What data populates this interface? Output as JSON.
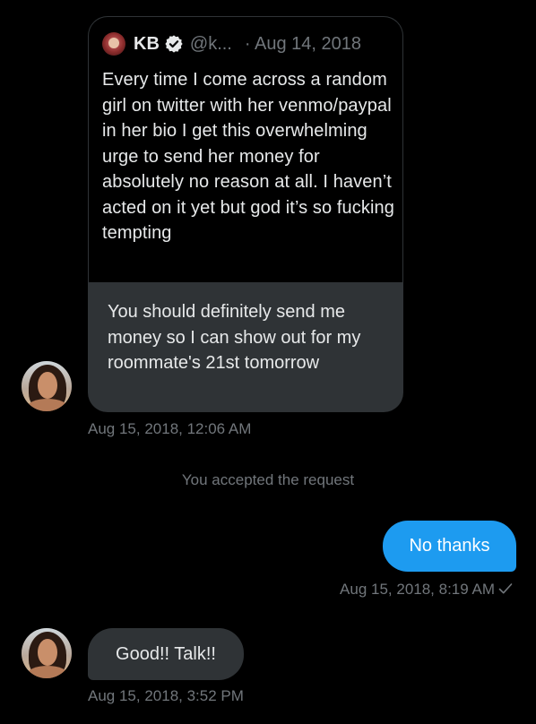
{
  "conversation": {
    "quoted_tweet": {
      "author_name": "KB",
      "handle": "@k...",
      "date": "· Aug 14, 2018",
      "text": "Every time I come across a random girl on twitter with her venmo/paypal in her bio I get this overwhelming urge to send her money for absolutely no reason at all. I haven’t acted on it yet but god it’s so fucking tempting"
    },
    "message_1": {
      "text": "You should definitely send me money so I can show out for my roommate's 21st tomorrow",
      "timestamp": "Aug 15, 2018, 12:06 AM"
    },
    "system_note": "You accepted the request",
    "message_2": {
      "text": "No thanks",
      "timestamp": "Aug 15, 2018, 8:19 AM"
    },
    "message_3": {
      "text": "Good!! Talk!!",
      "timestamp": "Aug 15, 2018, 3:52 PM"
    }
  },
  "colors": {
    "background": "#000000",
    "sent_bubble": "#1d9bf0",
    "received_bubble": "#2f3336",
    "secondary_text": "#71767b"
  },
  "icons": {
    "verified": "verified-badge-icon",
    "read_receipt": "checkmark-icon"
  }
}
